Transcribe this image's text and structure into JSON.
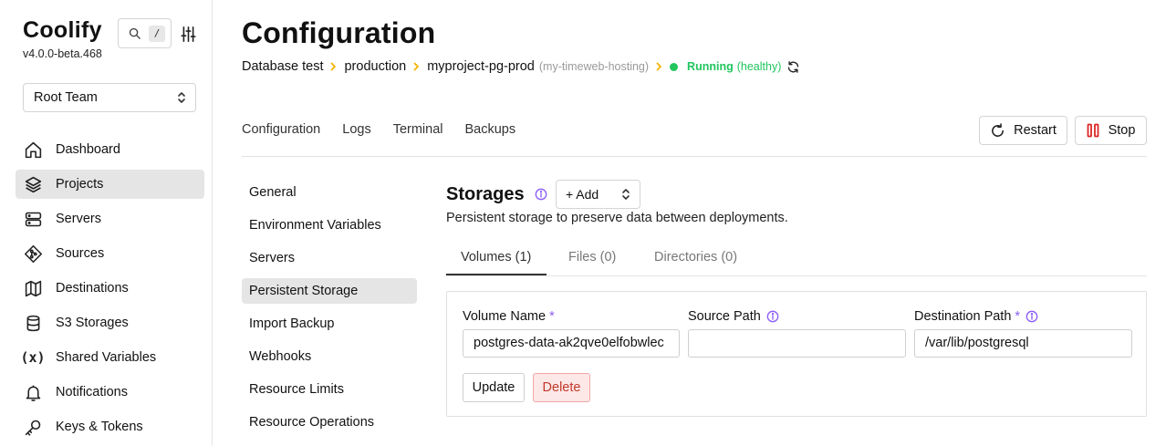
{
  "app": {
    "name": "Coolify",
    "version": "v4.0.0-beta.468"
  },
  "search": {
    "shortcut": "/",
    "icon": "search-icon"
  },
  "team": {
    "selected": "Root Team"
  },
  "sidebar": {
    "items": [
      {
        "label": "Dashboard",
        "icon": "home-icon",
        "active": false
      },
      {
        "label": "Projects",
        "icon": "layers-icon",
        "active": true
      },
      {
        "label": "Servers",
        "icon": "server-icon",
        "active": false
      },
      {
        "label": "Sources",
        "icon": "git-icon",
        "active": false
      },
      {
        "label": "Destinations",
        "icon": "map-icon",
        "active": false
      },
      {
        "label": "S3 Storages",
        "icon": "database-icon",
        "active": false
      },
      {
        "label": "Shared Variables",
        "icon": "variable-icon",
        "active": false
      },
      {
        "label": "Notifications",
        "icon": "bell-icon",
        "active": false
      },
      {
        "label": "Keys & Tokens",
        "icon": "key-icon",
        "active": false
      }
    ]
  },
  "page": {
    "title": "Configuration",
    "breadcrumb": {
      "project": "Database test",
      "environment": "production",
      "resource": "myproject-pg-prod",
      "server": "(my-timeweb-hosting)",
      "status": "Running",
      "health": "(healthy)"
    },
    "tabs": [
      "Configuration",
      "Logs",
      "Terminal",
      "Backups"
    ],
    "actions": {
      "restart": "Restart",
      "stop": "Stop"
    }
  },
  "subnav": {
    "items": [
      {
        "label": "General",
        "active": false
      },
      {
        "label": "Environment Variables",
        "active": false
      },
      {
        "label": "Servers",
        "active": false
      },
      {
        "label": "Persistent Storage",
        "active": true
      },
      {
        "label": "Import Backup",
        "active": false
      },
      {
        "label": "Webhooks",
        "active": false
      },
      {
        "label": "Resource Limits",
        "active": false
      },
      {
        "label": "Resource Operations",
        "active": false
      }
    ]
  },
  "storages": {
    "title": "Storages",
    "add_label": "+ Add",
    "description": "Persistent storage to preserve data between deployments.",
    "tabs": [
      {
        "label": "Volumes (1)",
        "active": true
      },
      {
        "label": "Files (0)",
        "active": false
      },
      {
        "label": "Directories (0)",
        "active": false
      }
    ],
    "volume": {
      "name_label": "Volume Name",
      "name_value": "postgres-data-ak2qve0elfobwlec",
      "source_label": "Source Path",
      "source_value": "",
      "dest_label": "Destination Path",
      "dest_value": "/var/lib/postgresql",
      "required_mark": "*",
      "update_label": "Update",
      "delete_label": "Delete"
    }
  },
  "colors": {
    "accent": "#8b5cf6",
    "running": "#22c55e",
    "breadcrumb_chevron": "#f5b400",
    "stop": "#dc2626",
    "delete_text": "#c0392b",
    "delete_bg": "#fde8e8"
  }
}
